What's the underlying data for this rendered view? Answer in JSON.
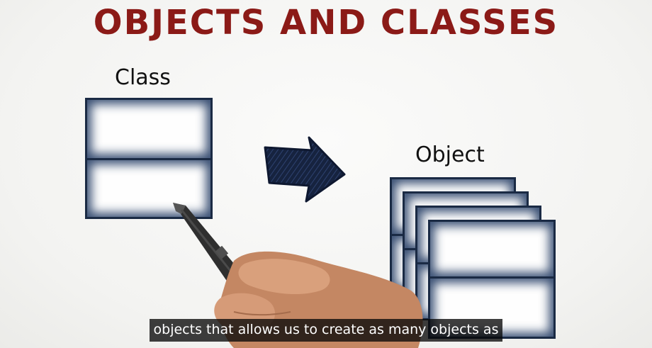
{
  "title": "OBJECTS AND CLASSES",
  "labels": {
    "class": "Class",
    "object": "Object"
  },
  "caption": "objects that allows us to create as many objects as",
  "colors": {
    "title": "#8b1a17",
    "box_border": "#1a2a44",
    "arrow": "#16233f",
    "caption_bg": "#141414"
  }
}
